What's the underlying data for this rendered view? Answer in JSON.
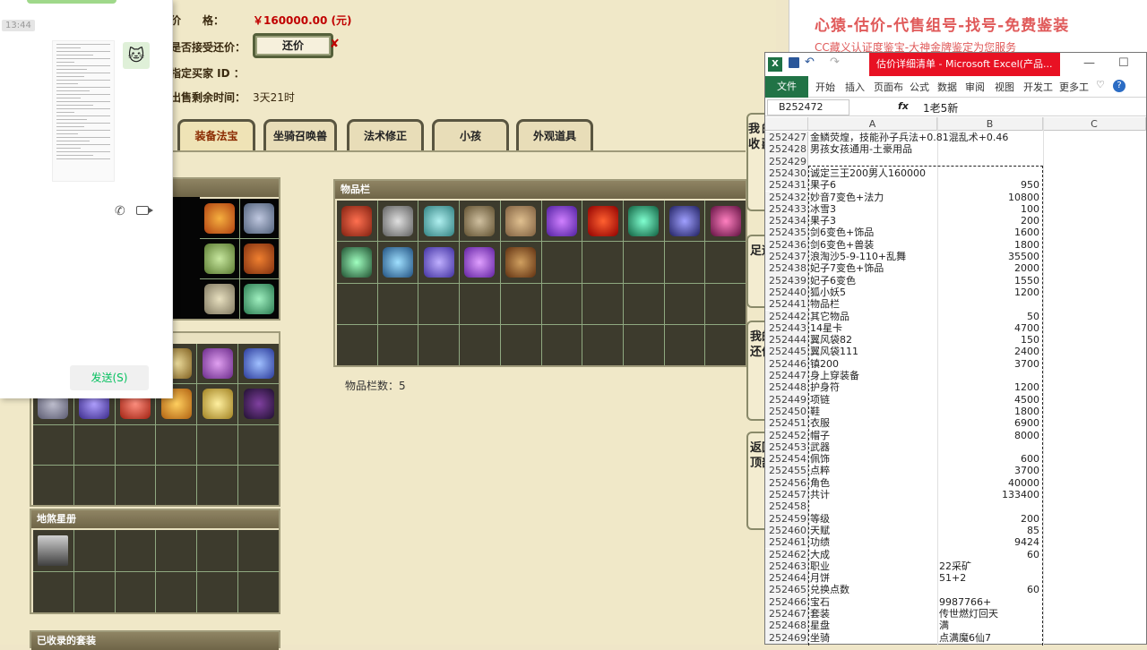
{
  "game": {
    "price_label": "价　　格：",
    "price_value": "￥160000.00 (元)",
    "accept_counter_label": "是否接受还价：",
    "counter_button": "还价",
    "buyer_id_label": "指定买家 ID ：",
    "remaining_time_label": "出售剩余时间：",
    "remaining_time_value": "3天21时",
    "tabs": [
      "装备法宝",
      "坐骑召唤兽",
      "法术修正",
      "小孩",
      "外观道具"
    ],
    "inventory_title": "物品栏",
    "inventory_count_label": "物品栏数：5",
    "star_book_title": "地煞星册",
    "bottom_title": "已收录的套装",
    "side_buttons": [
      "我的收藏",
      "足迹",
      "我的还价",
      "返回顶部"
    ]
  },
  "chat": {
    "time": "13:44",
    "send_button": "发送(S)"
  },
  "banner": {
    "line1": "心猿-估价-代售组号-找号-免费鉴装",
    "line2": "CC藏义认证度鉴宝-大神金牌鉴定为您服务"
  },
  "excel": {
    "title": "估价详细清单 - Microsoft Excel(产品...",
    "ribbon_tabs": [
      "文件",
      "开始",
      "插入",
      "页面布",
      "公式",
      "数据",
      "审阅",
      "视图",
      "开发工",
      "更多工"
    ],
    "name_box": "B252472",
    "fx": "fx",
    "formula_value": "1老5新",
    "columns": [
      "A",
      "B",
      "C"
    ],
    "rows": [
      {
        "n": "252427",
        "a": "金鳞荧煌，技能孙子兵法+0.81混乱术+0.46",
        "b": ""
      },
      {
        "n": "252428",
        "a": "男孩女孩通用-土豪用品",
        "b": ""
      },
      {
        "n": "252429",
        "a": "",
        "b": ""
      },
      {
        "n": "252430",
        "a": "诚定三王200男人160000",
        "b": ""
      },
      {
        "n": "252431",
        "a": "果子6",
        "b": "950"
      },
      {
        "n": "252432",
        "a": "妙音7变色+法力",
        "b": "10800"
      },
      {
        "n": "252433",
        "a": "冰雪3",
        "b": "100"
      },
      {
        "n": "252434",
        "a": "果子3",
        "b": "200"
      },
      {
        "n": "252435",
        "a": "剑6变色+饰品",
        "b": "1600"
      },
      {
        "n": "252436",
        "a": "剑6变色+兽装",
        "b": "1800"
      },
      {
        "n": "252437",
        "a": "浪淘沙5-9-110+乱舞",
        "b": "35500"
      },
      {
        "n": "252438",
        "a": "妃子7变色+饰品",
        "b": "2000"
      },
      {
        "n": "252439",
        "a": "妃子6变色",
        "b": "1550"
      },
      {
        "n": "252440",
        "a": "狐小妖5",
        "b": "1200"
      },
      {
        "n": "252441",
        "a": "物品栏",
        "b": ""
      },
      {
        "n": "252442",
        "a": "其它物品",
        "b": "50"
      },
      {
        "n": "252443",
        "a": "14星卡",
        "b": "4700"
      },
      {
        "n": "252444",
        "a": "翼风袋82",
        "b": "150"
      },
      {
        "n": "252445",
        "a": "翼风袋111",
        "b": "2400"
      },
      {
        "n": "252446",
        "a": "镇200",
        "b": "3700"
      },
      {
        "n": "252447",
        "a": "身上穿装备",
        "b": ""
      },
      {
        "n": "252448",
        "a": "护身符",
        "b": "1200"
      },
      {
        "n": "252449",
        "a": "项链",
        "b": "4500"
      },
      {
        "n": "252450",
        "a": "鞋",
        "b": "1800"
      },
      {
        "n": "252451",
        "a": "衣服",
        "b": "6900"
      },
      {
        "n": "252452",
        "a": "帽子",
        "b": "8000"
      },
      {
        "n": "252453",
        "a": "武器",
        "b": ""
      },
      {
        "n": "252454",
        "a": "佩饰",
        "b": "600"
      },
      {
        "n": "252455",
        "a": "点粹",
        "b": "3700"
      },
      {
        "n": "252456",
        "a": "角色",
        "b": "40000"
      },
      {
        "n": "252457",
        "a": "共计",
        "b": "133400"
      },
      {
        "n": "252458",
        "a": "",
        "b": ""
      },
      {
        "n": "252459",
        "a": "等级",
        "b": "200"
      },
      {
        "n": "252460",
        "a": "天赋",
        "b": "85"
      },
      {
        "n": "252461",
        "a": "功绩",
        "b": "9424"
      },
      {
        "n": "252462",
        "a": "大成",
        "b": "60"
      },
      {
        "n": "252463",
        "a": "职业",
        "b": "22采矿",
        "left": true
      },
      {
        "n": "252464",
        "a": "月饼",
        "b": "51+2",
        "left": true
      },
      {
        "n": "252465",
        "a": "兑换点数",
        "b": "60"
      },
      {
        "n": "252466",
        "a": "宝石",
        "b": "9987766+",
        "left": true
      },
      {
        "n": "252467",
        "a": "套装",
        "b": "传世燃灯回天",
        "left": true
      },
      {
        "n": "252468",
        "a": "星盘",
        "b": "满",
        "left": true
      },
      {
        "n": "252469",
        "a": "坐骑",
        "b": "点满魔6仙7",
        "left": true
      }
    ]
  },
  "colors": {
    "price": "#c00000",
    "excel_green": "#217346",
    "title_red": "#e81123"
  }
}
